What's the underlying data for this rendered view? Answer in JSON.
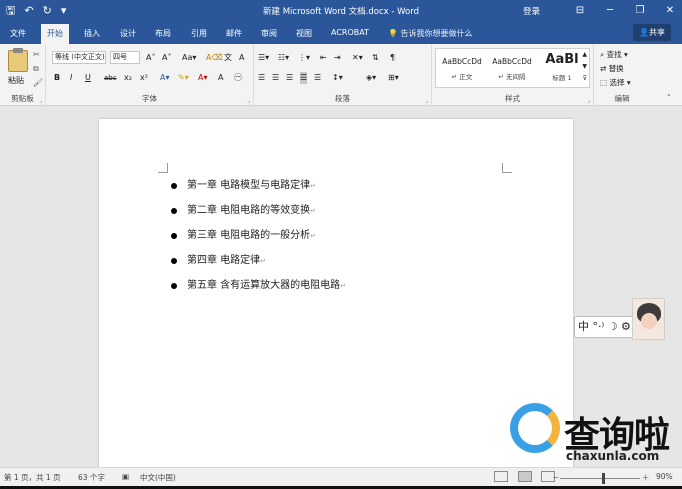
{
  "titlebar": {
    "save_icon": "save-icon",
    "undo_icon": "undo-icon",
    "redo_icon": "redo-icon",
    "customize_icon": "chevron-down-icon",
    "document_title": "新建 Microsoft Word 文档.docx  -  Word",
    "sign_in": "登录",
    "ribbon_display_icon": "ribbon-display-icon",
    "minimize_icon": "minimize-icon",
    "restore_icon": "restore-icon",
    "close_icon": "close-icon"
  },
  "tabs": [
    {
      "label": "文件",
      "active": false
    },
    {
      "label": "开始",
      "active": true
    },
    {
      "label": "插入",
      "active": false
    },
    {
      "label": "设计",
      "active": false
    },
    {
      "label": "布局",
      "active": false
    },
    {
      "label": "引用",
      "active": false
    },
    {
      "label": "邮件",
      "active": false
    },
    {
      "label": "审阅",
      "active": false
    },
    {
      "label": "视图",
      "active": false
    },
    {
      "label": "ACROBAT",
      "active": false
    }
  ],
  "tell_me": "告诉我你想要做什么",
  "share": "共享",
  "ribbon": {
    "clipboard": {
      "paste": "粘贴",
      "label": "剪贴板"
    },
    "font": {
      "font_name": "等线 (中文正文)",
      "font_size": "四号",
      "buttons": [
        "B",
        "I",
        "U",
        "abc",
        "x₂",
        "x²"
      ],
      "label": "字体"
    },
    "paragraph": {
      "label": "段落"
    },
    "styles": {
      "items": [
        {
          "preview": "AaBbCcDd",
          "name": "↵ 正文"
        },
        {
          "preview": "AaBbCcDd",
          "name": "↵ 无间隔"
        },
        {
          "preview": "AaBl",
          "name": "标题 1"
        }
      ],
      "label": "样式"
    },
    "editing": {
      "find": "查找",
      "replace": "替换",
      "select": "选择",
      "label": "编辑"
    }
  },
  "document": {
    "bullet_items": [
      "第一章  电路模型与电路定律",
      "第二章  电阻电路的等效变换",
      "第三章  电阻电路的一般分析",
      "第四章  电路定律",
      "第五章  含有运算放大器的电阻电路"
    ],
    "paragraph_mark": "↵"
  },
  "ime": {
    "text": "中 °·⁾ ☽ ⚙"
  },
  "watermark": {
    "name": "查询啦",
    "url": "chaxunla.com"
  },
  "status": {
    "page": "第 1 页，共 1 页",
    "words": "63 个字",
    "language": "中文(中国)",
    "zoom_minus": "－",
    "zoom_plus": "＋",
    "zoom": "90%"
  }
}
